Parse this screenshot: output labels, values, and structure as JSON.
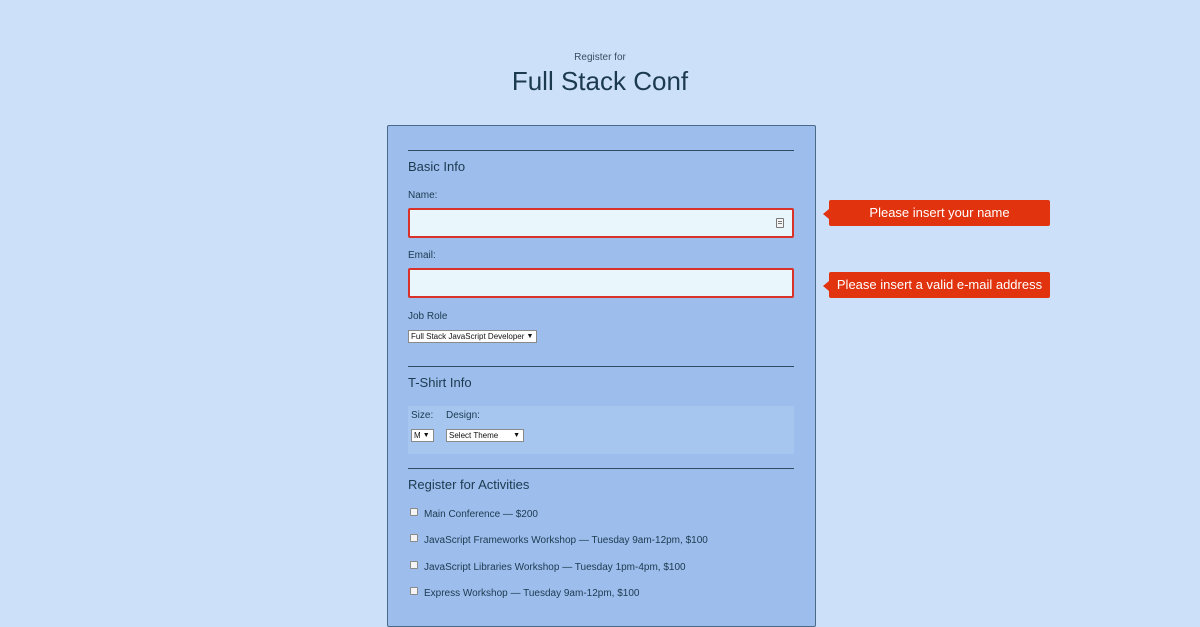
{
  "header": {
    "subtitle": "Register for",
    "title": "Full Stack Conf"
  },
  "basic_info": {
    "section_title": "Basic Info",
    "name_label": "Name:",
    "name_value": "",
    "email_label": "Email:",
    "email_value": "",
    "job_role_label": "Job Role",
    "job_role_selected": "Full Stack JavaScript Developer"
  },
  "tshirt_info": {
    "section_title": "T-Shirt Info",
    "size_label": "Size:",
    "size_selected": "M",
    "design_label": "Design:",
    "design_selected": "Select Theme"
  },
  "activities": {
    "section_title": "Register for Activities",
    "items": [
      {
        "label": "Main Conference — $200",
        "checked": false
      },
      {
        "label": "JavaScript Frameworks Workshop — Tuesday 9am-12pm, $100",
        "checked": false
      },
      {
        "label": "JavaScript Libraries Workshop — Tuesday 1pm-4pm, $100",
        "checked": false
      },
      {
        "label": "Express Workshop — Tuesday 9am-12pm, $100",
        "checked": false
      }
    ]
  },
  "errors": {
    "name": "Please insert your name",
    "email": "Please insert a valid e-mail address"
  },
  "colors": {
    "page_background": "#cce0fa",
    "form_background": "#9dbdec",
    "error_red": "#e1330d",
    "input_background": "#e9f6fb"
  },
  "icons": {
    "name_field_icon": "autofill-contact-icon",
    "select_arrow": "triangle-down-icon"
  }
}
